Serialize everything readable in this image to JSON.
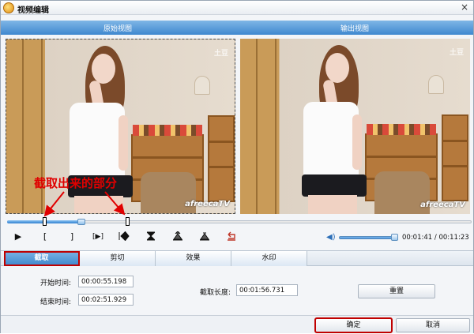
{
  "window": {
    "title": "视频编辑",
    "close_glyph": "×"
  },
  "views": {
    "original_label": "原始视图",
    "output_label": "输出视图",
    "watermark_text": "afreecaTV",
    "corner_logo_text": "土豆"
  },
  "annotation": {
    "text": "截取出来的部分",
    "color": "#e00000"
  },
  "timeline": {
    "progress_fraction": 0.16,
    "selection_start_fraction": 0.077,
    "selection_end_fraction": 0.255
  },
  "controls": {
    "play_icon": "play-icon",
    "set_start_glyph": "[",
    "set_end_glyph": "]",
    "play_selection_glyph": "[▶]",
    "volume_fraction": 0.95,
    "current_time": "00:01:41",
    "total_time": "00:11:23",
    "time_separator": "/"
  },
  "tabs": [
    {
      "label": "截取",
      "active": true
    },
    {
      "label": "剪切",
      "active": false
    },
    {
      "label": "效果",
      "active": false
    },
    {
      "label": "水印",
      "active": false
    }
  ],
  "trim": {
    "start_label": "开始时间:",
    "start_value": "00:00:55.198",
    "end_label": "结束时间:",
    "end_value": "00:02:51.929",
    "length_label": "截取长度:",
    "length_value": "00:01:56.731",
    "reset_label": "重置"
  },
  "footer": {
    "ok_label": "确定",
    "cancel_label": "取消"
  },
  "colors": {
    "accent_blue": "#3f88cf",
    "highlight_red": "#c00000"
  }
}
